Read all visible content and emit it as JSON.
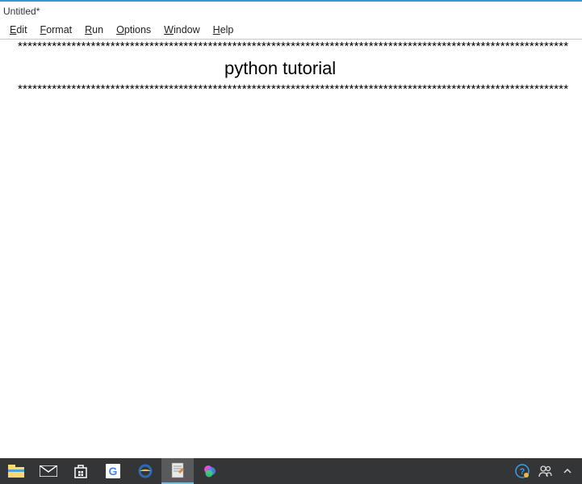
{
  "window": {
    "title": "Untitled*"
  },
  "menu": {
    "edit": "Edit",
    "format": "Format",
    "run": "Run",
    "options": "Options",
    "window": "Window",
    "help": "Help"
  },
  "document": {
    "stars1": "*****************************************************************************************************************",
    "heading": "python tutorial",
    "stars2": "*****************************************************************************************************************"
  }
}
